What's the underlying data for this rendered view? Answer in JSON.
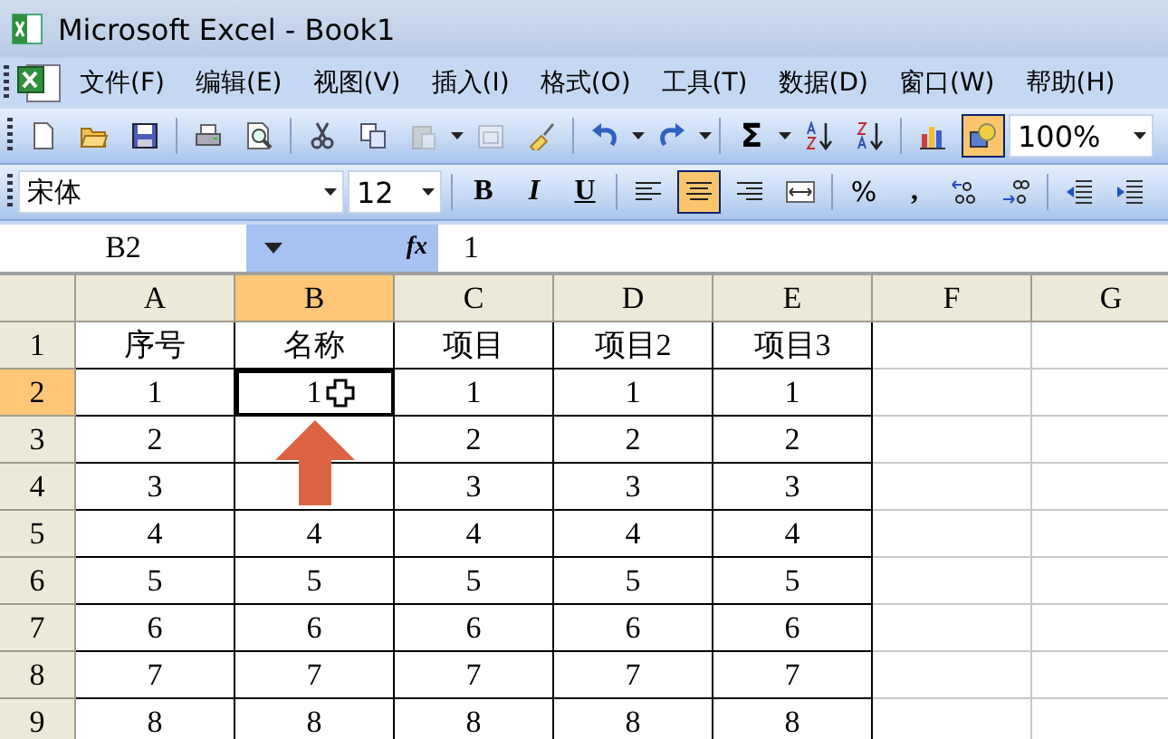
{
  "window": {
    "title": "Microsoft Excel - Book1"
  },
  "menu": [
    "文件(F)",
    "编辑(E)",
    "视图(V)",
    "插入(I)",
    "格式(O)",
    "工具(T)",
    "数据(D)",
    "窗口(W)",
    "帮助(H)"
  ],
  "standard_toolbar": {
    "buttons": [
      {
        "kind": "new",
        "pressed": false
      },
      {
        "kind": "open",
        "pressed": false
      },
      {
        "kind": "save",
        "pressed": false
      },
      {
        "kind": "sep"
      },
      {
        "kind": "print",
        "pressed": false
      },
      {
        "kind": "preview",
        "pressed": false
      },
      {
        "kind": "sep"
      },
      {
        "kind": "cut",
        "pressed": false
      },
      {
        "kind": "copy",
        "pressed": false
      },
      {
        "kind": "paste",
        "pressed": false,
        "disabled": true
      },
      {
        "kind": "dropdown"
      },
      {
        "kind": "calendar",
        "pressed": false,
        "disabled": true
      },
      {
        "kind": "brush",
        "pressed": false
      },
      {
        "kind": "sep"
      },
      {
        "kind": "undo",
        "pressed": false
      },
      {
        "kind": "dropdown"
      },
      {
        "kind": "redo",
        "pressed": false
      },
      {
        "kind": "dropdown"
      },
      {
        "kind": "sep"
      },
      {
        "kind": "sum",
        "pressed": false,
        "label": "Σ"
      },
      {
        "kind": "dropdown"
      },
      {
        "kind": "sortasc",
        "pressed": false
      },
      {
        "kind": "sortdesc",
        "pressed": false
      },
      {
        "kind": "sep"
      },
      {
        "kind": "chart",
        "pressed": false
      },
      {
        "kind": "drawing",
        "pressed": true
      }
    ],
    "zoom": "100%"
  },
  "formatting_toolbar": {
    "font": "宋体",
    "size": "12",
    "buttons": [
      {
        "kind": "bold",
        "pressed": false,
        "label": "B"
      },
      {
        "kind": "italic",
        "pressed": false,
        "label": "I"
      },
      {
        "kind": "underline",
        "pressed": false,
        "label": "U"
      },
      {
        "kind": "sep"
      },
      {
        "kind": "alignleft",
        "pressed": false
      },
      {
        "kind": "aligncenter",
        "pressed": true
      },
      {
        "kind": "alignright",
        "pressed": false
      },
      {
        "kind": "merge",
        "pressed": false
      },
      {
        "kind": "sep"
      },
      {
        "kind": "percent",
        "pressed": false,
        "label": "%"
      },
      {
        "kind": "comma",
        "pressed": false,
        "label": ","
      },
      {
        "kind": "incdec",
        "pressed": false
      },
      {
        "kind": "decdec",
        "pressed": false
      },
      {
        "kind": "sep"
      },
      {
        "kind": "outdent",
        "pressed": false
      },
      {
        "kind": "indent",
        "pressed": false
      }
    ]
  },
  "formula_bar": {
    "name_box": "B2",
    "fx": "fx",
    "value": "1"
  },
  "sheet": {
    "columns": [
      {
        "label": "A",
        "selected": false,
        "bordered": true
      },
      {
        "label": "B",
        "selected": true,
        "bordered": true
      },
      {
        "label": "C",
        "selected": false,
        "bordered": true
      },
      {
        "label": "D",
        "selected": false,
        "bordered": true
      },
      {
        "label": "E",
        "selected": false,
        "bordered": true
      },
      {
        "label": "F",
        "selected": false,
        "bordered": false
      },
      {
        "label": "G",
        "selected": false,
        "bordered": false
      }
    ],
    "rows": [
      {
        "label": "1",
        "selected": false,
        "cells": [
          "序号",
          "名称",
          "项目",
          "项目2",
          "项目3"
        ]
      },
      {
        "label": "2",
        "selected": true,
        "cells": [
          "1",
          "1",
          "1",
          "1",
          "1"
        ]
      },
      {
        "label": "3",
        "selected": false,
        "cells": [
          "2",
          "",
          "2",
          "2",
          "2"
        ]
      },
      {
        "label": "4",
        "selected": false,
        "cells": [
          "3",
          "",
          "3",
          "3",
          "3"
        ]
      },
      {
        "label": "5",
        "selected": false,
        "cells": [
          "4",
          "4",
          "4",
          "4",
          "4"
        ]
      },
      {
        "label": "6",
        "selected": false,
        "cells": [
          "5",
          "5",
          "5",
          "5",
          "5"
        ]
      },
      {
        "label": "7",
        "selected": false,
        "cells": [
          "6",
          "6",
          "6",
          "6",
          "6"
        ]
      },
      {
        "label": "8",
        "selected": false,
        "cells": [
          "7",
          "7",
          "7",
          "7",
          "7"
        ]
      },
      {
        "label": "9",
        "selected": false,
        "cells": [
          "8",
          "8",
          "8",
          "8",
          "8"
        ]
      }
    ]
  }
}
